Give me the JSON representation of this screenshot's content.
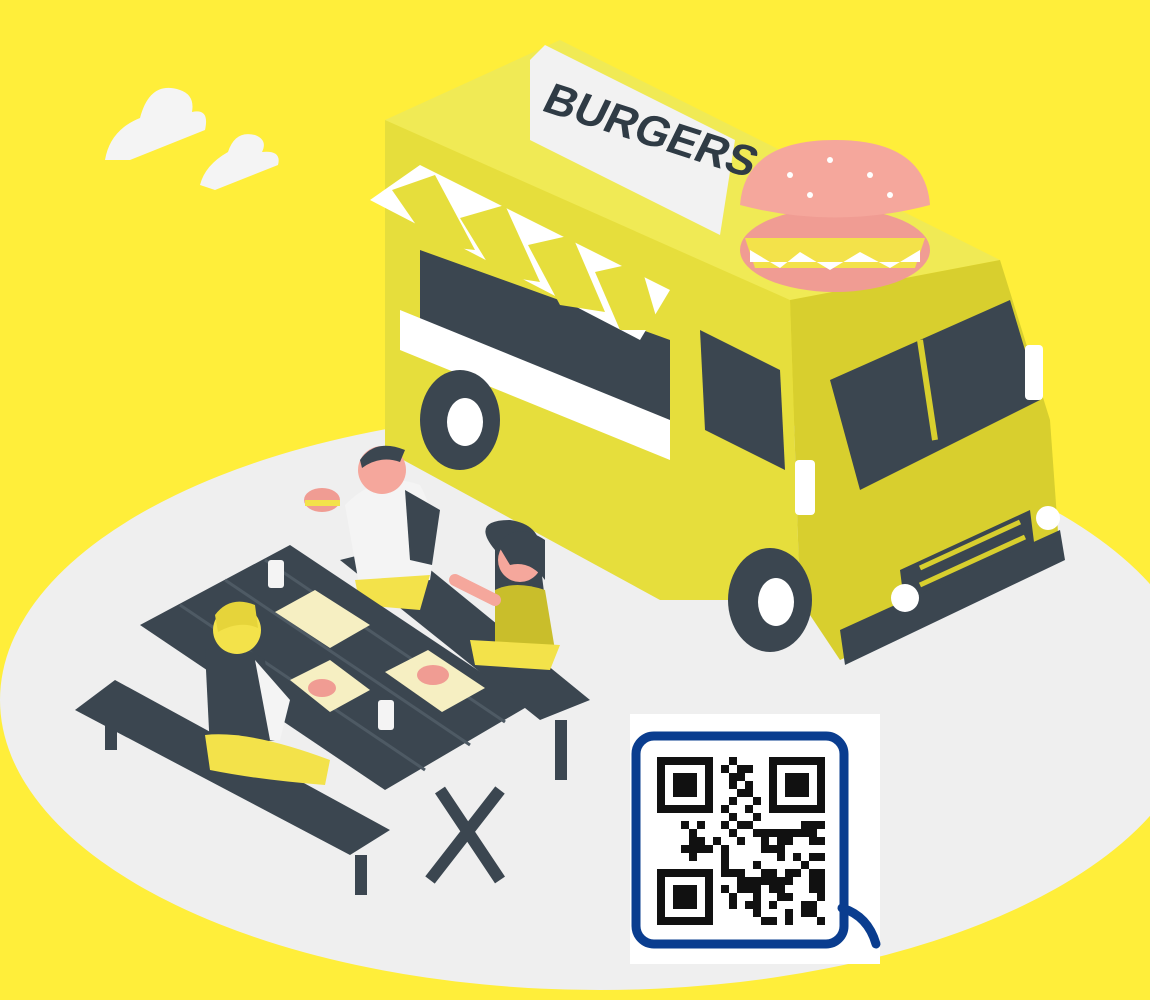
{
  "illustration": {
    "sign_text": "BURGERS"
  },
  "colors": {
    "background": "#FFEE3A",
    "ground": "#EFEFEF",
    "truck_body": "#E6DE3C",
    "truck_dark": "#3B4650",
    "awning_white": "#FFFFFF",
    "bun": "#F5A79C",
    "qr_border": "#0A3D8F"
  },
  "qr_code": {
    "icon": "qr-code-icon"
  }
}
